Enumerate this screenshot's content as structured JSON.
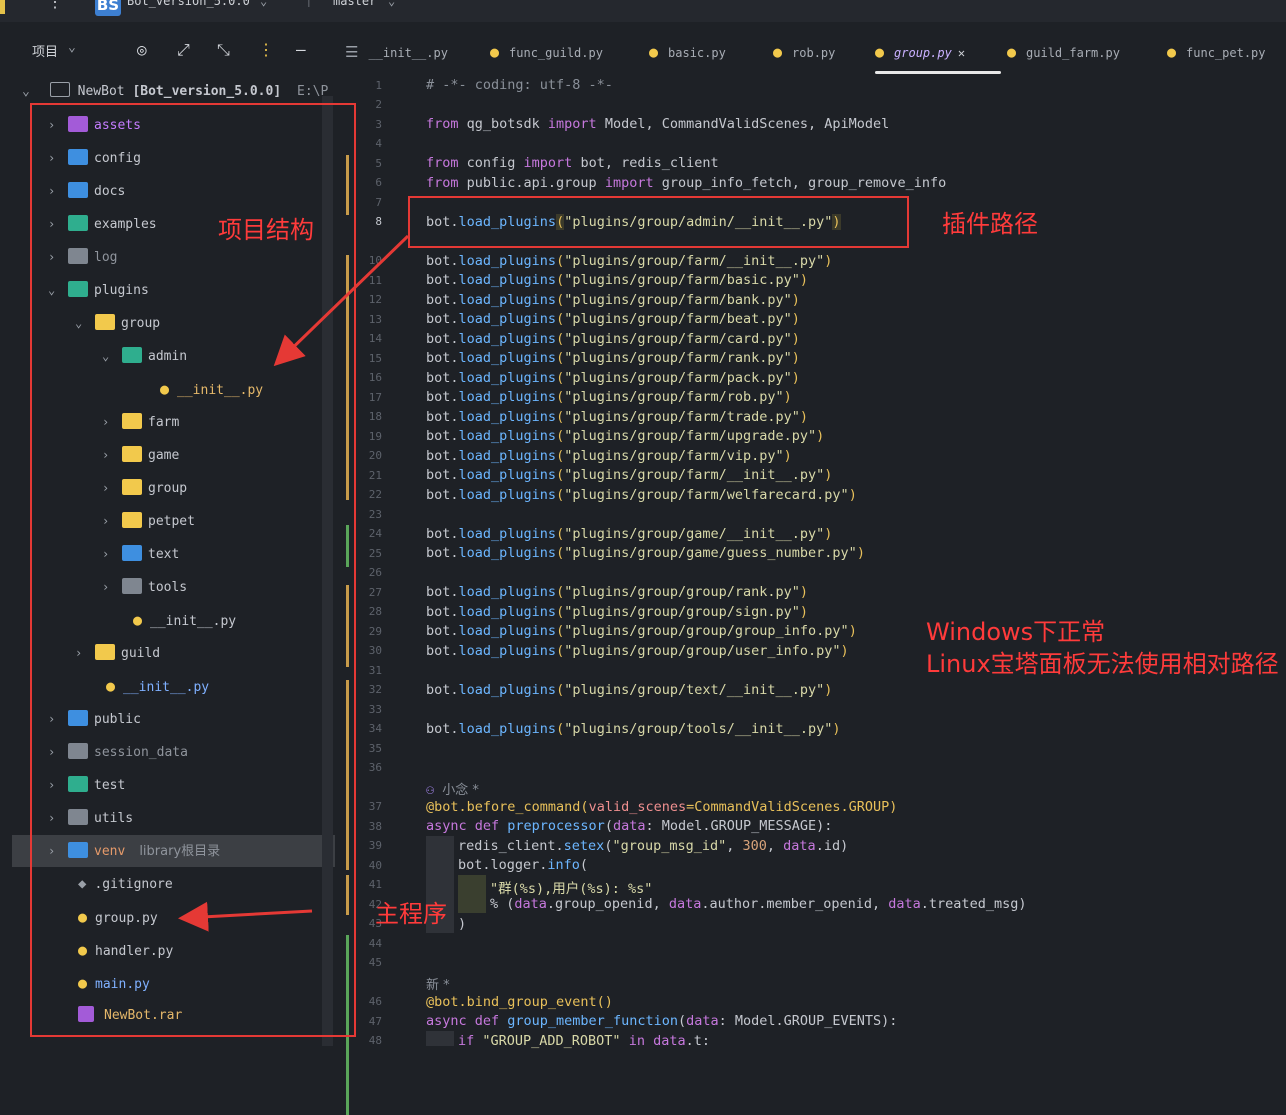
{
  "topbar": {
    "project_badge": "BS",
    "project_name": "Bot_version_5.0.0",
    "branch": "master"
  },
  "sidebar": {
    "title": "项目",
    "root_name": "NewBot",
    "root_tag": "[Bot_version_5.0.0]",
    "root_path": "E:\\P",
    "items": [
      {
        "label": "assets"
      },
      {
        "label": "config"
      },
      {
        "label": "docs"
      },
      {
        "label": "examples"
      },
      {
        "label": "log"
      },
      {
        "label": "plugins"
      },
      {
        "label": "group"
      },
      {
        "label": "admin"
      },
      {
        "label": "__init__.py"
      },
      {
        "label": "farm"
      },
      {
        "label": "game"
      },
      {
        "label": "group"
      },
      {
        "label": "petpet"
      },
      {
        "label": "text"
      },
      {
        "label": "tools"
      },
      {
        "label": "__init__.py"
      },
      {
        "label": "guild"
      },
      {
        "label": "__init__.py"
      },
      {
        "label": "public"
      },
      {
        "label": "session_data"
      },
      {
        "label": "test"
      },
      {
        "label": "utils"
      },
      {
        "label": "venv",
        "extra": "library根目录"
      },
      {
        "label": ".gitignore"
      },
      {
        "label": "group.py"
      },
      {
        "label": "handler.py"
      },
      {
        "label": "main.py"
      },
      {
        "label": "NewBot.rar"
      }
    ]
  },
  "tabs": [
    {
      "label": "__init__.py"
    },
    {
      "label": "func_guild.py"
    },
    {
      "label": "basic.py"
    },
    {
      "label": "rob.py"
    },
    {
      "label": "group.py",
      "active": true
    },
    {
      "label": "guild_farm.py"
    },
    {
      "label": "func_pet.py"
    }
  ],
  "code": {
    "line_numbers": [
      "1",
      "2",
      "3",
      "4",
      "5",
      "6",
      "7",
      "8",
      "10",
      "11",
      "12",
      "13",
      "14",
      "15",
      "16",
      "17",
      "18",
      "19",
      "20",
      "21",
      "22",
      "23",
      "24",
      "25",
      "26",
      "27",
      "28",
      "29",
      "30",
      "31",
      "32",
      "33",
      "34",
      "35",
      "36",
      "37",
      "38",
      "39",
      "40",
      "41",
      "42",
      "43",
      "44",
      "45",
      "46",
      "47",
      "48"
    ],
    "l1": "# -*- coding: utf-8 -*-",
    "l3": [
      "from",
      " qg_botsdk ",
      "import",
      " Model, CommandValidScenes, ApiModel"
    ],
    "l5": [
      "from",
      " config ",
      "import",
      " bot, redis_client"
    ],
    "l6": [
      "from",
      " public.api.group ",
      "import",
      " group_info_fetch, group_remove_info"
    ],
    "load_prefix": "bot.",
    "load_fn": "load_plugins",
    "plugin_paths": [
      "\"plugins/group/admin/__init__.py\"",
      "\"plugins/group/farm/__init__.py\"",
      "\"plugins/group/farm/basic.py\"",
      "\"plugins/group/farm/bank.py\"",
      "\"plugins/group/farm/beat.py\"",
      "\"plugins/group/farm/card.py\"",
      "\"plugins/group/farm/rank.py\"",
      "\"plugins/group/farm/pack.py\"",
      "\"plugins/group/farm/rob.py\"",
      "\"plugins/group/farm/trade.py\"",
      "\"plugins/group/farm/upgrade.py\"",
      "\"plugins/group/farm/vip.py\"",
      "\"plugins/group/farm/__init__.py\"",
      "\"plugins/group/farm/welfarecard.py\"",
      "\"plugins/group/game/__init__.py\"",
      "\"plugins/group/game/guess_number.py\"",
      "\"plugins/group/group/rank.py\"",
      "\"plugins/group/group/sign.py\"",
      "\"plugins/group/group/group_info.py\"",
      "\"plugins/group/group/user_info.py\"",
      "\"plugins/group/text/__init__.py\"",
      "\"plugins/group/tools/__init__.py\""
    ],
    "author1": "小念 *",
    "dec1": [
      "@bot.before_command(",
      "valid_scenes",
      "=CommandValidScenes.GROUP)"
    ],
    "def1": [
      "async",
      " def ",
      "preprocessor",
      "(",
      "data",
      ": Model.GROUP_MESSAGE):"
    ],
    "l39": [
      "redis_client.",
      "setex",
      "(",
      "\"group_msg_id\"",
      ", ",
      "300",
      ", ",
      "data",
      ".id)"
    ],
    "l40": [
      "bot.logger.",
      "info",
      "("
    ],
    "l41": "\"群(%s),用户(%s): %s\"",
    "l42": [
      "% (",
      "data",
      ".group_openid, ",
      "data",
      ".author.member_openid, ",
      "data",
      ".treated_msg)"
    ],
    "l43": ")",
    "author2": "新 *",
    "dec2": "@bot.bind_group_event()",
    "def2": [
      "async",
      " def ",
      "group_member_function",
      "(",
      "data",
      ": Model.GROUP_EVENTS):"
    ],
    "l48": [
      "if ",
      "\"GROUP_ADD_ROBOT\"",
      " in ",
      "data",
      ".t:"
    ]
  },
  "annotations": {
    "tree": "项目结构",
    "plugin_path": "插件路径",
    "main": "主程序",
    "note1": "Windows下正常",
    "note2": "Linux宝塔面板无法使用相对路径"
  },
  "colors": {
    "annotation_red": "#e53935",
    "python_yellow": "#f2c94c",
    "keyword_purple": "#c678dd",
    "function_blue": "#6cb6ff"
  }
}
